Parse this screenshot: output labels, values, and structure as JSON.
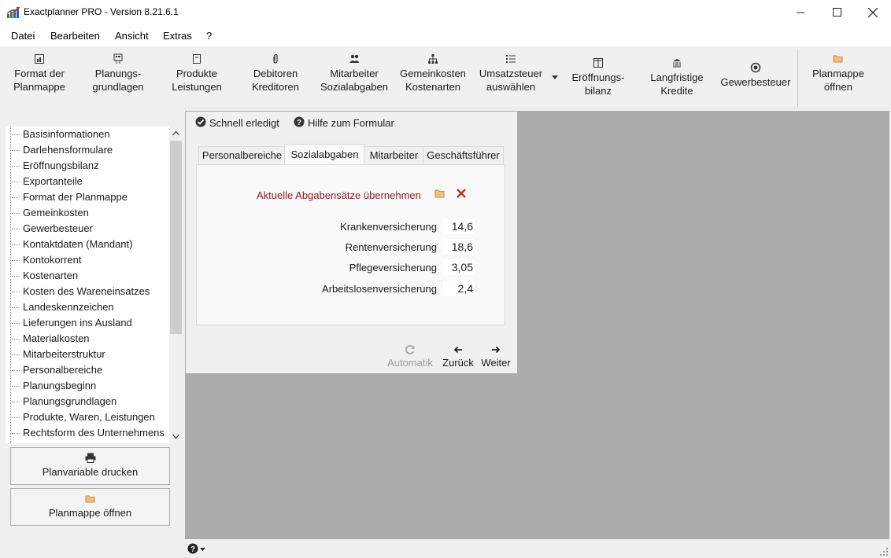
{
  "window": {
    "title": "Exactplanner PRO - Version 8.21.6.1"
  },
  "menu": [
    "Datei",
    "Bearbeiten",
    "Ansicht",
    "Extras",
    "?"
  ],
  "toolbar": {
    "format": [
      "Format der",
      "Planmappe"
    ],
    "planungs": [
      "Planungs-",
      "grundlagen"
    ],
    "produkte": [
      "Produkte",
      "Leistungen"
    ],
    "debitoren": [
      "Debitoren",
      "Kreditoren"
    ],
    "mitarbeiter": [
      "Mitarbeiter",
      "Sozialabgaben"
    ],
    "gemeinkosten": [
      "Gemeinkosten",
      "Kostenarten"
    ],
    "umsatzsteuer": [
      "Umsatzsteuer",
      "auswählen"
    ],
    "eroeffnung": [
      "Eröffnungs-",
      "bilanz"
    ],
    "langfristig": [
      "Langfristige",
      "Kredite"
    ],
    "gewerbesteuer": "Gewerbesteuer",
    "planmappe": [
      "Planmappe",
      "öffnen"
    ]
  },
  "sidebar": {
    "tree": [
      "Basisinformationen",
      "Darlehensformulare",
      "Eröffnungsbilanz",
      "Exportanteile",
      "Format der Planmappe",
      "Gemeinkosten",
      "Gewerbesteuer",
      "Kontaktdaten (Mandant)",
      "Kontokorrent",
      "Kostenarten",
      "Kosten des Wareneinsatzes",
      "Landeskennzeichen",
      "Lieferungen ins Ausland",
      "Materialkosten",
      "Mitarbeiterstruktur",
      "Personalbereiche",
      "Planungsbeginn",
      "Planungsgrundlagen",
      "Produkte, Waren, Leistungen",
      "Rechtsform des Unternehmens"
    ],
    "print_button": "Planvariable drucken",
    "open_button": "Planmappe öffnen"
  },
  "form": {
    "schnell": "Schnell erledigt",
    "hilfe": "Hilfe zum Formular",
    "tabs": [
      "Personalbereiche",
      "Sozialabgaben",
      "Mitarbeiter",
      "Geschäftsführer"
    ],
    "active_tab": "Sozialabgaben",
    "action_link": "Aktuelle Abgabensätze übernehmen",
    "fields": [
      {
        "label": "Krankenversicherung",
        "value": "14,6"
      },
      {
        "label": "Rentenversicherung",
        "value": "18,6"
      },
      {
        "label": "Pflegeversicherung",
        "value": "3,05"
      },
      {
        "label": "Arbeitslosenversicherung",
        "value": "2,4"
      }
    ],
    "nav": {
      "automatik": "Automatik",
      "zurueck": "Zurück",
      "weiter": "Weiter"
    }
  },
  "colors": {
    "action_link": "#8b1a1a",
    "delete_icon": "#c0341c",
    "folder_icon": "#e0a050",
    "workspace": "#ababab"
  }
}
